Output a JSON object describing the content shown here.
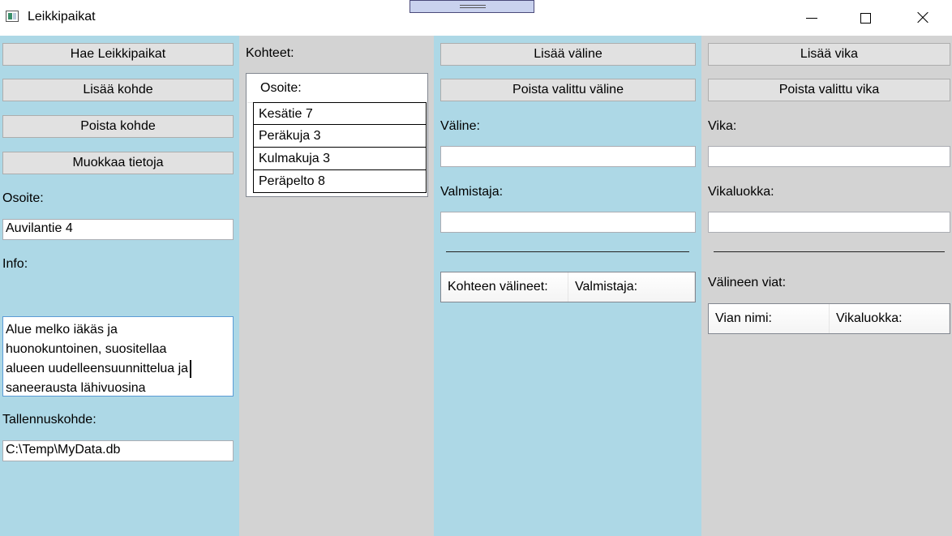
{
  "window": {
    "title": "Leikkipaikat"
  },
  "left": {
    "buttons": {
      "fetch": "Hae Leikkipaikat",
      "add": "Lisää kohde",
      "remove": "Poista kohde",
      "edit": "Muokkaa tietoja"
    },
    "address_label": "Osoite:",
    "address_value": "Auvilantie 4",
    "info_label": "Info:",
    "info_lines": [
      "Alue melko iäkäs ja",
      "huonokuntoinen, suositellaa",
      "alueen uudelleensuunnittelua ja",
      "saneerausta lähivuosina"
    ],
    "storage_label": "Tallennuskohde:",
    "storage_value": "C:\\Temp\\MyData.db"
  },
  "targets": {
    "label": "Kohteet:",
    "column_header": "Osoite:",
    "rows": [
      "Kesätie 7",
      "Peräkuja 3",
      "Kulmakuja 3",
      "Peräpelto 8"
    ]
  },
  "equipment": {
    "add_button": "Lisää väline",
    "remove_button": "Poista valittu väline",
    "name_label": "Väline:",
    "name_value": "",
    "maker_label": "Valmistaja:",
    "maker_value": "",
    "columns": [
      "Kohteen välineet:",
      "Valmistaja:"
    ]
  },
  "faults": {
    "add_button": "Lisää vika",
    "remove_button": "Poista valittu vika",
    "name_label": "Vika:",
    "name_value": "",
    "class_label": "Vikaluokka:",
    "class_value": "",
    "list_label": "Välineen viat:",
    "columns": [
      "Vian nimi:",
      "Vikaluokka:"
    ]
  },
  "colors": {
    "blue_panel": "#add8e6",
    "gray_panel": "#d3d3d3",
    "button": "#e1e1e1"
  },
  "icons": {
    "app": "app-icon",
    "minimize": "minimize-icon",
    "maximize": "maximize-icon",
    "close": "close-icon"
  }
}
